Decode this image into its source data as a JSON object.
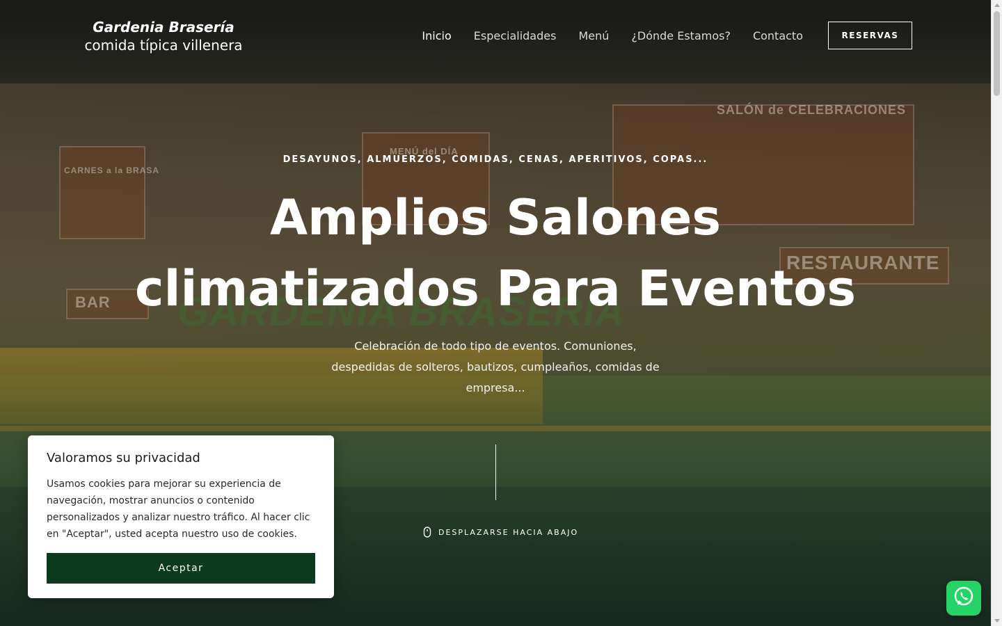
{
  "header": {
    "logo": {
      "name": "Gardenia Brasería",
      "tagline": "comida típica villenera"
    },
    "nav": [
      {
        "label": "Inicio",
        "active": true
      },
      {
        "label": "Especialidades",
        "active": false
      },
      {
        "label": "Menú",
        "active": false
      },
      {
        "label": "¿Dónde Estamos?",
        "active": false
      },
      {
        "label": "Contacto",
        "active": false
      }
    ],
    "cta_label": "RESERVAS"
  },
  "hero": {
    "eyebrow": "DESAYUNOS, ALMUERZOS, COMIDAS, CENAS, APERITIVOS, COPAS...",
    "headline_line1": "Amplios Salones",
    "headline_line2": "climatizados Para Eventos",
    "subtext": "Celebración de todo tipo de eventos. Comuniones, despedidas de solteros, bautizos, cumpleaños, comidas de empresa...",
    "scroll_label": "DESPLAZARSE HACIA ABAJO",
    "scroll_icon": "mouse-icon",
    "background_signs": {
      "salon": "SALÓN de CELEBRACIONES",
      "menu": "MENÚ del DÍA",
      "carnes": "CARNES a la BRASA",
      "restaurante": "RESTAURANTE",
      "bar": "BAR",
      "brand": "GARDENIA BRASERÍA"
    }
  },
  "cookie_banner": {
    "title": "Valoramos su privacidad",
    "text": "Usamos cookies para mejorar su experiencia de navegación, mostrar anuncios o contenido personalizados y analizar nuestro tráfico. Al hacer clic en \"Aceptar\", usted acepta nuestro uso de cookies.",
    "accept_label": "Aceptar",
    "accept_color": "#0b3a1f"
  },
  "whatsapp": {
    "icon": "whatsapp-icon",
    "color": "#25d366"
  }
}
